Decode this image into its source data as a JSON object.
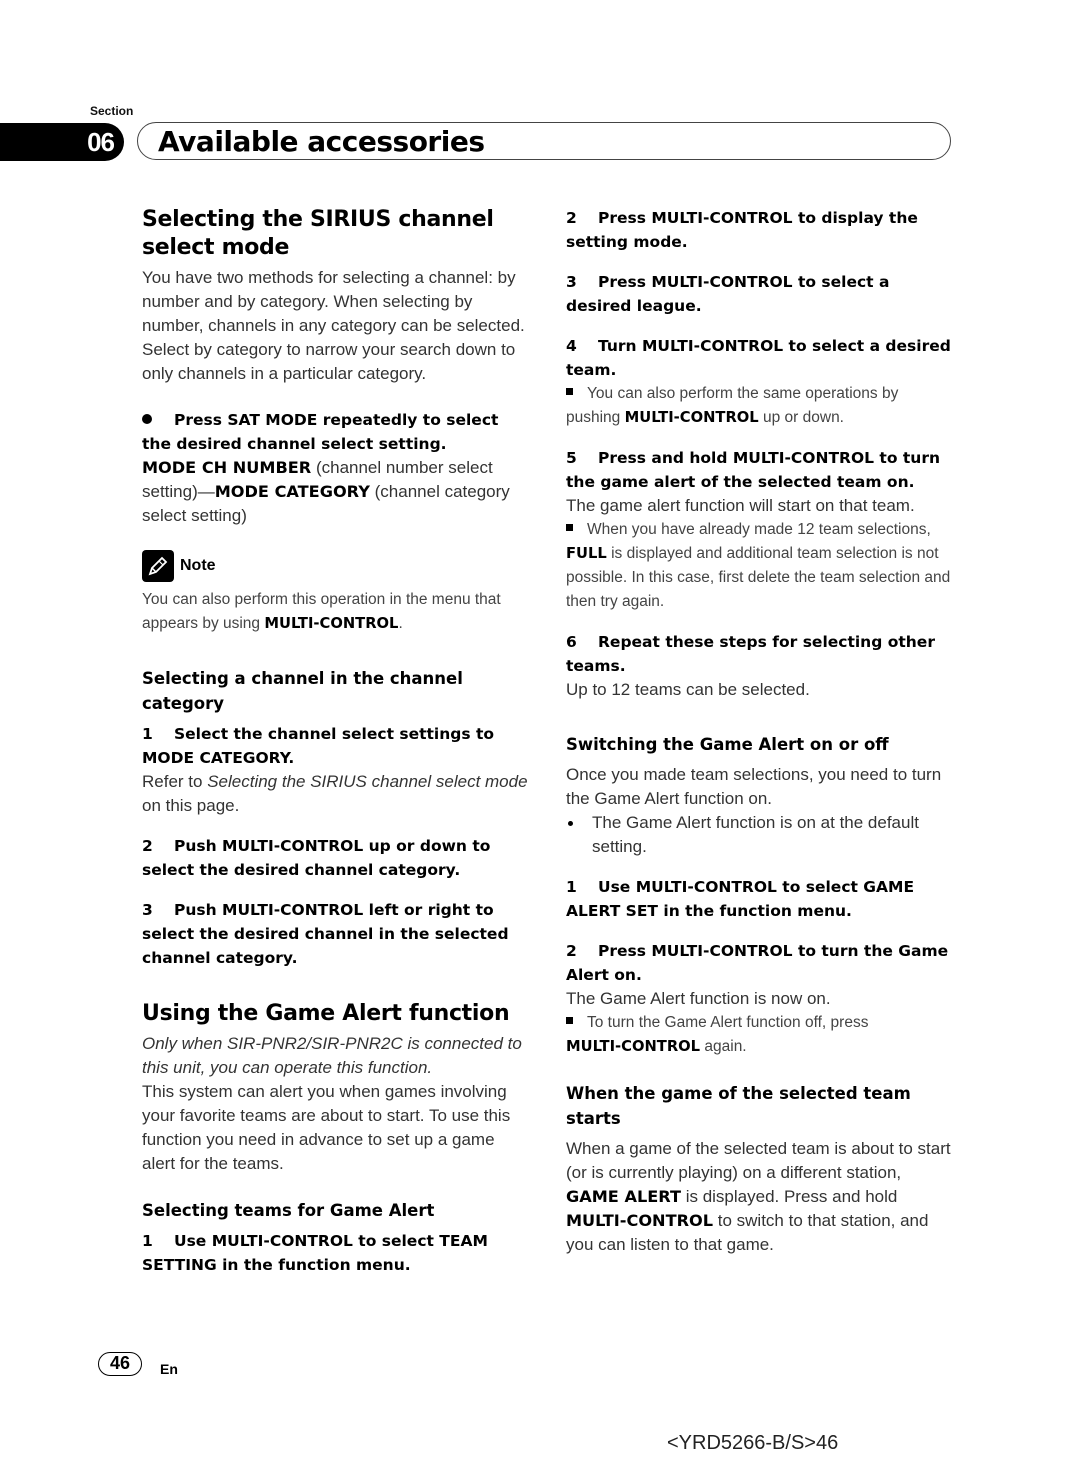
{
  "header": {
    "section_label": "Section",
    "section_number": "06",
    "title": "Available accessories"
  },
  "left": {
    "h_select_mode": "Selecting the SIRIUS channel select mode",
    "intro": "You have two methods for selecting a channel: by number and by category. When selecting by number, channels in any category can be selected. Select by category to narrow your search down to only channels in a particular category.",
    "press_sat_step": "Press SAT MODE repeatedly to select the desired channel select setting.",
    "mode_ch_number": "MODE CH NUMBER",
    "mode_ch_number_desc": " (channel number select setting)—",
    "mode_category": "MODE CATEGORY",
    "mode_category_desc": " (channel category select setting)",
    "note_label": "Note",
    "note_text": "You can also perform this operation in the menu that appears by using ",
    "note_bold": "MULTI-CONTROL",
    "note_end": ".",
    "h_channel_category": "Selecting a channel in the channel category",
    "cat_steps": [
      {
        "num": "1",
        "text": "Select the channel select settings to MODE CATEGORY."
      },
      {
        "num": "2",
        "text": "Push MULTI-CONTROL up or down to select the desired channel category."
      },
      {
        "num": "3",
        "text": "Push MULTI-CONTROL left or right to select the desired channel in the selected channel category."
      }
    ],
    "refer_prefix": "Refer to ",
    "refer_link": "Selecting the SIRIUS channel select mode",
    "refer_suffix": " on this page.",
    "h_game_alert": "Using the Game Alert function",
    "game_alert_italic": "Only when SIR-PNR2/SIR-PNR2C is connected to this unit, you can operate this function.",
    "game_alert_body": "This system can alert you when games involving your favorite teams are about to start. To use this function you need in advance to set up a game alert for the teams.",
    "h_selecting_teams": "Selecting teams for Game Alert",
    "team_step1": {
      "num": "1",
      "text": "Use MULTI-CONTROL to select TEAM SETTING in the function menu."
    }
  },
  "right": {
    "team_steps": [
      {
        "num": "2",
        "text": "Press MULTI-CONTROL to display the setting mode."
      },
      {
        "num": "3",
        "text": "Press MULTI-CONTROL to select a desired league."
      },
      {
        "num": "4",
        "text": "Turn MULTI-CONTROL to select a desired team."
      }
    ],
    "step4_note_pre": "You can also perform the same operations by pushing ",
    "step4_note_bold": "MULTI-CONTROL",
    "step4_note_post": " up or down.",
    "step5": {
      "num": "5",
      "text": "Press and hold MULTI-CONTROL to turn the game alert of the selected team on."
    },
    "step5_body": "The game alert function will start on that team.",
    "step5_note_pre": "When you have already made 12 team selections, ",
    "step5_note_bold": "FULL",
    "step5_note_post": " is displayed and additional team selection is not possible. In this case, first delete the team selection and then try again.",
    "step6": {
      "num": "6",
      "text": "Repeat these steps for selecting other teams."
    },
    "step6_body": "Up to 12 teams can be selected.",
    "h_switching": "Switching the Game Alert on or off",
    "switching_body": "Once you made team selections, you need to turn the Game Alert function on.",
    "switching_bullet": "The Game Alert function is on at the default setting.",
    "switch_steps": [
      {
        "num": "1",
        "text": "Use MULTI-CONTROL to select GAME ALERT SET in the function menu."
      },
      {
        "num": "2",
        "text": "Press MULTI-CONTROL to turn the Game Alert on."
      }
    ],
    "switch_body": "The Game Alert function is now on.",
    "switch_note_pre": "To turn the Game Alert function off, press ",
    "switch_note_bold": "MULTI-CONTROL",
    "switch_note_post": " again.",
    "h_when_game": "When the game of the selected team starts",
    "when_pre": "When a game of the selected team is about to start (or is currently playing) on a different station, ",
    "when_bold1": "GAME ALERT",
    "when_mid": " is displayed. Press and hold ",
    "when_bold2": "MULTI-CONTROL",
    "when_post": " to switch to that station, and you can listen to that game."
  },
  "footer": {
    "page_number": "46",
    "language": "En",
    "doc_code": "<YRD5266-B/S>46"
  }
}
